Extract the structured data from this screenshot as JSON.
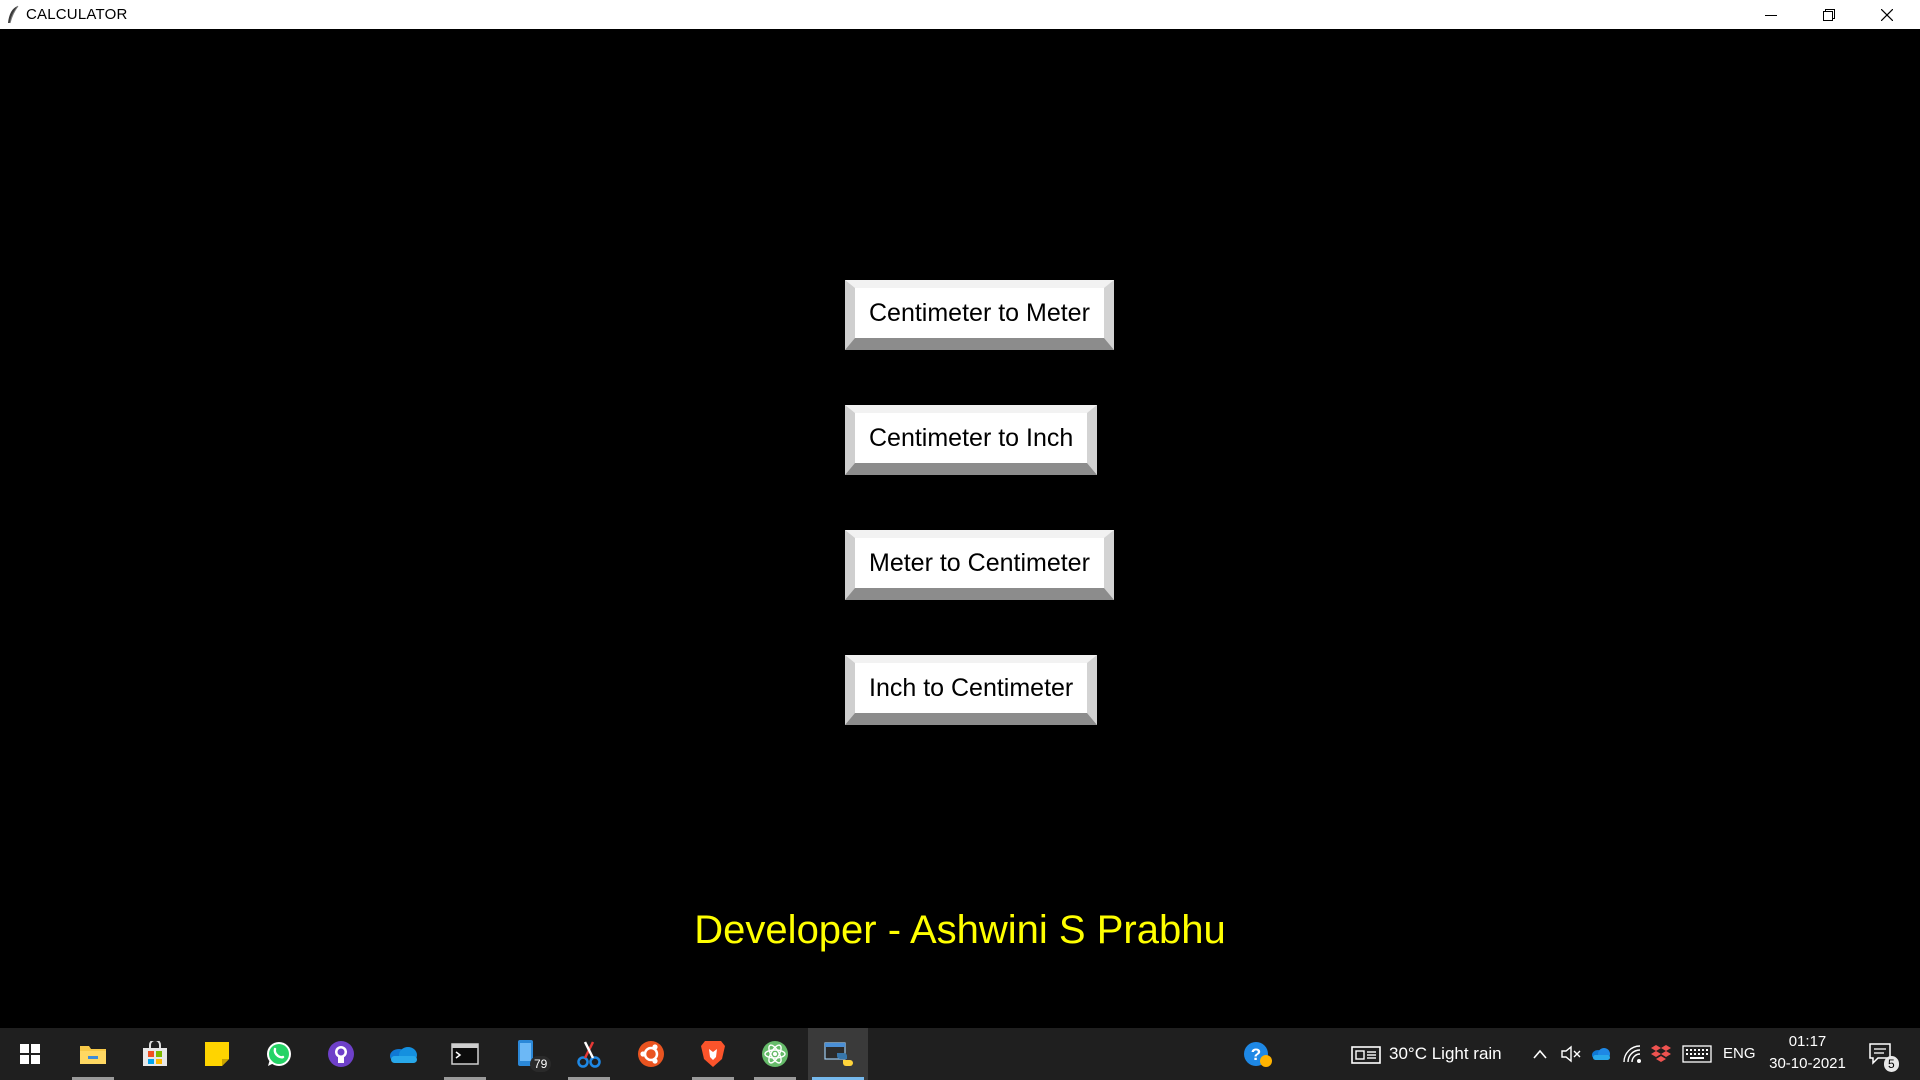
{
  "window": {
    "title": "CALCULATOR"
  },
  "main": {
    "buttons": [
      {
        "label": "Centimeter to Meter"
      },
      {
        "label": "Centimeter to Inch"
      },
      {
        "label": "Meter to Centimeter"
      },
      {
        "label": "Inch to Centimeter"
      }
    ],
    "developer_credit": "Developer - Ashwini S Prabhu"
  },
  "taskbar": {
    "apps": [
      {
        "icon": "windows-start-icon"
      },
      {
        "icon": "file-explorer-icon"
      },
      {
        "icon": "microsoft-store-icon"
      },
      {
        "icon": "sticky-notes-icon"
      },
      {
        "icon": "whatsapp-icon"
      },
      {
        "icon": "github-icon"
      },
      {
        "icon": "onedrive-icon"
      },
      {
        "icon": "terminal-icon"
      },
      {
        "icon": "phone-link-icon",
        "badge": "79"
      },
      {
        "icon": "snipping-tool-icon"
      },
      {
        "icon": "ubuntu-icon"
      },
      {
        "icon": "brave-icon"
      },
      {
        "icon": "atom-icon"
      },
      {
        "icon": "python-icon"
      }
    ],
    "weather": "30°C  Light rain",
    "language": "ENG",
    "time": "01:17",
    "date": "30-10-2021",
    "notifications_count": "5"
  },
  "colors": {
    "background": "#000000",
    "credit_text": "#ffff00",
    "taskbar": "#1f1f1f",
    "button_face": "#ffffff"
  }
}
